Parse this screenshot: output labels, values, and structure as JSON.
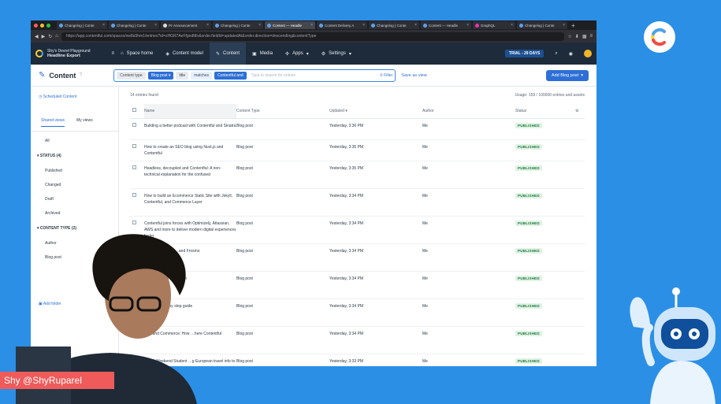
{
  "browser": {
    "tabs": [
      {
        "label": "Changelog | Conte",
        "active": false
      },
      {
        "label": "Changelog | Conte",
        "active": false
      },
      {
        "label": "Pr-Announcement",
        "active": false
      },
      {
        "label": "Changelog | Conte",
        "active": false
      },
      {
        "label": "Content — Headle",
        "active": true
      },
      {
        "label": "Content Delivery A",
        "active": false
      },
      {
        "label": "Changelog | Conte",
        "active": false
      },
      {
        "label": "Content — Headle",
        "active": false
      },
      {
        "label": "GraphQL",
        "active": false
      },
      {
        "label": "Changelog | Conte",
        "active": false
      }
    ],
    "url": "https://app.contentful.com/spaces/xw8a5hm1/entries?id=xHGR7AeFfgndMn&order.fieldId=updatedAt&order.direction=descending&contentType"
  },
  "topnav": {
    "space_name": "Shy's Devrel Playground",
    "environment": "Headline Export",
    "items": [
      "Space home",
      "Content model",
      "Content",
      "Media",
      "Apps",
      "Settings"
    ],
    "trial": "TRIAL - 29 DAYS"
  },
  "header": {
    "title": "Content",
    "content_type_label": "Content type",
    "content_type_value": "Blog post",
    "field_label": "title",
    "operator": "matches",
    "query": "Contentful and",
    "placeholder": "Type to search for entries",
    "filter": "Filter",
    "save_view": "Save as view",
    "add_button": "Add Blog post"
  },
  "sidebar": {
    "scheduled": "Scheduled Content",
    "shared_views": "Shared views",
    "my_views": "My views",
    "all": "All",
    "status_heading": "STATUS (4)",
    "status_items": [
      "Published",
      "Changed",
      "Draft",
      "Archived"
    ],
    "ctype_heading": "CONTENT TYPE (2)",
    "ctype_items": [
      "Author",
      "Blog post"
    ],
    "add_folder": "Add folder"
  },
  "list": {
    "count": "14 entries found",
    "usage": "Usage: 159 / 100000 entries and assets",
    "columns": [
      "Name",
      "Content Type",
      "Updated",
      "Author",
      "Status"
    ],
    "rows": [
      {
        "name": "Building a better podcast with Contentful and Sinatra",
        "type": "Blog post",
        "updated": "Yesterday, 3:36 PM",
        "author": "Me",
        "status": "PUBLISHED"
      },
      {
        "name": "How to create an SEO blog using Nuxt.js and Contentful",
        "type": "Blog post",
        "updated": "Yesterday, 3:35 PM",
        "author": "Me",
        "status": "PUBLISHED"
      },
      {
        "name": "Headless, decoupled and Contentful: A non-technical explanation for the confused",
        "type": "Blog post",
        "updated": "Yesterday, 3:35 PM",
        "author": "Me",
        "status": "PUBLISHED"
      },
      {
        "name": "How to build an Ecommerce Static Site with Jekyll, Contentful, and Commerce Layer",
        "type": "Blog post",
        "updated": "Yesterday, 3:34 PM",
        "author": "Me",
        "status": "PUBLISHED"
      },
      {
        "name": "Contentful joins forces with Optimizely, Atlassian, AWS and more to deliver modern digital experiences faster",
        "type": "Blog post",
        "updated": "Yesterday, 3:34 PM",
        "author": "Me",
        "status": "PUBLISHED"
      },
      {
        "name": "…for the modern …and Frosmo",
        "type": "Blog post",
        "updated": "Yesterday, 3:34 PM",
        "author": "Me",
        "status": "PUBLISHED"
      },
      {
        "name": "…views …with Jong von",
        "type": "Blog post",
        "updated": "Yesterday, 3:34 PM",
        "author": "Me",
        "status": "PUBLISHED"
      },
      {
        "name": "…Nuxt and …by step guide",
        "type": "Blog post",
        "updated": "Yesterday, 3:34 PM",
        "author": "Me",
        "status": "PUBLISHED"
      },
      {
        "name": "…nt and Commerce: How …here Contentful",
        "type": "Blog post",
        "updated": "Yesterday, 3:34 PM",
        "author": "Me",
        "status": "PUBLISHED"
      },
      {
        "name": "…and Weekend Student …g European travel info to",
        "type": "Blog post",
        "updated": "Yesterday, 3:33 PM",
        "author": "Me",
        "status": "PUBLISHED"
      }
    ]
  },
  "overlay": {
    "presenter": "Shy @ShyRuparel"
  },
  "colors": {
    "background": "#2b8fe6",
    "nav": "#1d2b3b",
    "accent": "#2d6fd6",
    "published_bg": "#dff2e4",
    "published_fg": "#1f7a3d",
    "name_card": "#ef5a5a"
  }
}
